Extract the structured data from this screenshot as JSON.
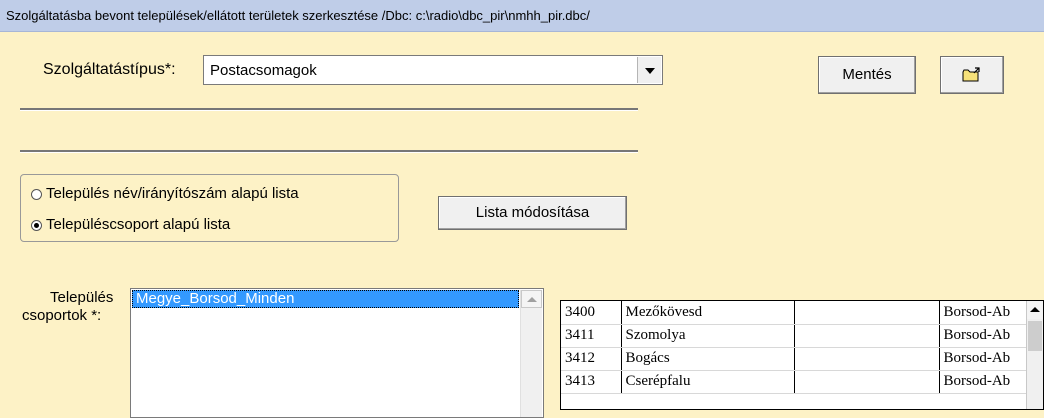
{
  "window": {
    "title": "Szolgáltatásba bevont települések/ellátott területek szerkesztése   /Dbc: c:\\radio\\dbc_pir\\nmhh_pir.dbc/"
  },
  "form": {
    "service_type_label": "Szolgáltatástípus*:",
    "service_type_value": "Postacsomagok",
    "save_label": "Mentés",
    "list_mode_options": [
      {
        "label": "Település név/irányítószám alapú lista",
        "selected": false
      },
      {
        "label": "Településcsoport alapú lista",
        "selected": true
      }
    ],
    "modify_list_label": "Lista módosítása",
    "groups_label_line1": "Település",
    "groups_label_line2": "csoportok *:",
    "groups": [
      {
        "name": "Megye_Borsod_Minden",
        "selected": true
      }
    ]
  },
  "settlements": [
    {
      "zip": "3400",
      "name": "Mezőkövesd",
      "extra": "",
      "county": "Borsod-Ab"
    },
    {
      "zip": "3411",
      "name": "Szomolya",
      "extra": "",
      "county": "Borsod-Ab"
    },
    {
      "zip": "3412",
      "name": "Bogács",
      "extra": "",
      "county": "Borsod-Ab"
    },
    {
      "zip": "3413",
      "name": "Cserépfalu",
      "extra": "",
      "county": "Borsod-Ab"
    }
  ],
  "icons": {
    "open_folder": "folder-open-icon",
    "combo_arrow": "chevron-down-icon",
    "scroll_up": "scroll-up-arrow-icon"
  },
  "colors": {
    "background": "#fdf2c6",
    "titlebar": "#bfcde8",
    "selection": "#3399ff"
  }
}
